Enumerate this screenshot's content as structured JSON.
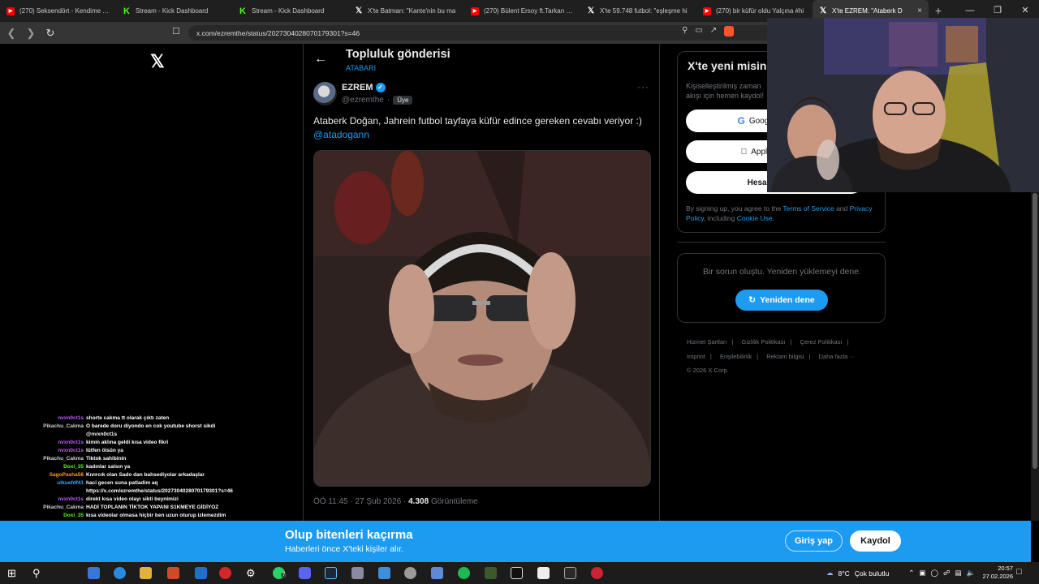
{
  "browser": {
    "tabs": [
      {
        "favicon": "youtube-icon",
        "title": "(270) Seksendört - Kendime Ya"
      },
      {
        "favicon": "kick-icon",
        "title": "Stream - Kick Dashboard"
      },
      {
        "favicon": "kick-icon",
        "title": "Stream - Kick Dashboard"
      },
      {
        "favicon": "x-icon",
        "title": "X'te Batman: \"Kante'nin bu ma"
      },
      {
        "favicon": "youtube-icon",
        "title": "(270) Bülent Ersoy ft.Tarkan - B"
      },
      {
        "favicon": "x-icon",
        "title": "X'te 59.748 futbol: \"eşleşme hi"
      },
      {
        "favicon": "youtube-icon",
        "title": "(270) bir küfür oldu Yalçına #hi"
      },
      {
        "favicon": "x-icon",
        "title": "X'te EZREM: \"Ataberk D"
      }
    ],
    "active_tab_index": 7,
    "new_tab": "+",
    "url": "x.com/ezremthe/status/2027304028070179301?s=46"
  },
  "post": {
    "page_title": "Topluluk gönderisi",
    "community": "ATABARI",
    "author_name": "EZREM",
    "author_handle": "@ezremthe",
    "separator": "·",
    "member_badge": "Üye",
    "text": "Ataberk Doğan, Jahrein futbol tayfaya küfür edince gereken cevabı veriyor :) ",
    "mention": "@atadogann",
    "time": "ÖÖ 11:45",
    "date": "27 Şub 2026",
    "views": "4.308",
    "views_label": "Görüntüleme"
  },
  "sidebar": {
    "signup_title": "X'te yeni misin?",
    "signup_sub": "Kişiselleştirilmiş zaman akışı için hemen kaydol!",
    "google_btn": "Google ile kaydol",
    "apple_btn": "Apple ile kaydol",
    "account_btn": "Hesap oluştur",
    "legal_pre": "By signing up, you agree to the ",
    "terms": "Terms of Service",
    "legal_and": " and ",
    "privacy": "Privacy Policy",
    "legal_including": ", including ",
    "cookie": "Cookie Use.",
    "error_text": "Bir sorun oluştu. Yeniden yüklemeyi dene.",
    "retry_btn": "Yeniden dene",
    "footer_links": [
      "Hizmet Şartları",
      "Gizlilik Politikası",
      "Çerez Politikası",
      "Imprint",
      "Erişilebilirlik",
      "Reklam bilgisi",
      "Daha fazla ···"
    ],
    "copyright": "© 2026 X Corp."
  },
  "chat": [
    {
      "user": "nvxn0ct1s",
      "color": "p",
      "text": "shorte cakma tt olarak çıktı zaten"
    },
    {
      "user": "Pikachu_Cakma",
      "color": "w",
      "text": "O barede doru diyondo en cok youtube shorst sikdi @nvxn0ct1s"
    },
    {
      "user": "nvxn0ct1s",
      "color": "p",
      "text": "kimin aklına geldi kısa video fikri"
    },
    {
      "user": "nvxn0ct1s",
      "color": "p",
      "text": "lütfen ölsün ya"
    },
    {
      "user": "Pikachu_Cakma",
      "color": "w",
      "text": "Tiktok sahibinin"
    },
    {
      "user": "Doxi_35",
      "color": "g",
      "text": "kadınlar salsın ya"
    },
    {
      "user": "SagoPasha58",
      "color": "o",
      "text": "Kıvırcık olan Sado dan bahsediyolar arkadaşlar"
    },
    {
      "user": "utkuefdf41",
      "color": "b",
      "text": "haci gecen suna patladim aq https://x.com/ezremthe/status/2027304028070179301?s=46"
    },
    {
      "user": "nvxn0ct1s",
      "color": "p",
      "text": "direkt kısa video olayı sikti beynimizi"
    },
    {
      "user": "Pikachu_Cakma",
      "color": "w",
      "text": "HADİ TOPLANIN TİKTOK YAPANI S1KMEYE GİDİYOZ"
    },
    {
      "user": "Doxi_35",
      "color": "g",
      "text": "kısa videolar olmasa hiçbir ben uzun oturup izlemezdim respect kısa videolar"
    }
  ],
  "banner": {
    "title": "Olup bitenleri kaçırma",
    "subtitle": "Haberleri önce X'teki kişiler alır.",
    "login_btn": "Giriş yap",
    "signup_btn": "Kaydol"
  },
  "taskbar": {
    "weather_temp": "8°C",
    "weather_desc": "Çok bulutlu",
    "time": "20:57",
    "date": "27.02.2026",
    "app_badge": "7"
  },
  "colors": {
    "accent": "#1d9bf0",
    "background": "#000000",
    "border": "#2f3336",
    "muted_text": "#71767b"
  }
}
